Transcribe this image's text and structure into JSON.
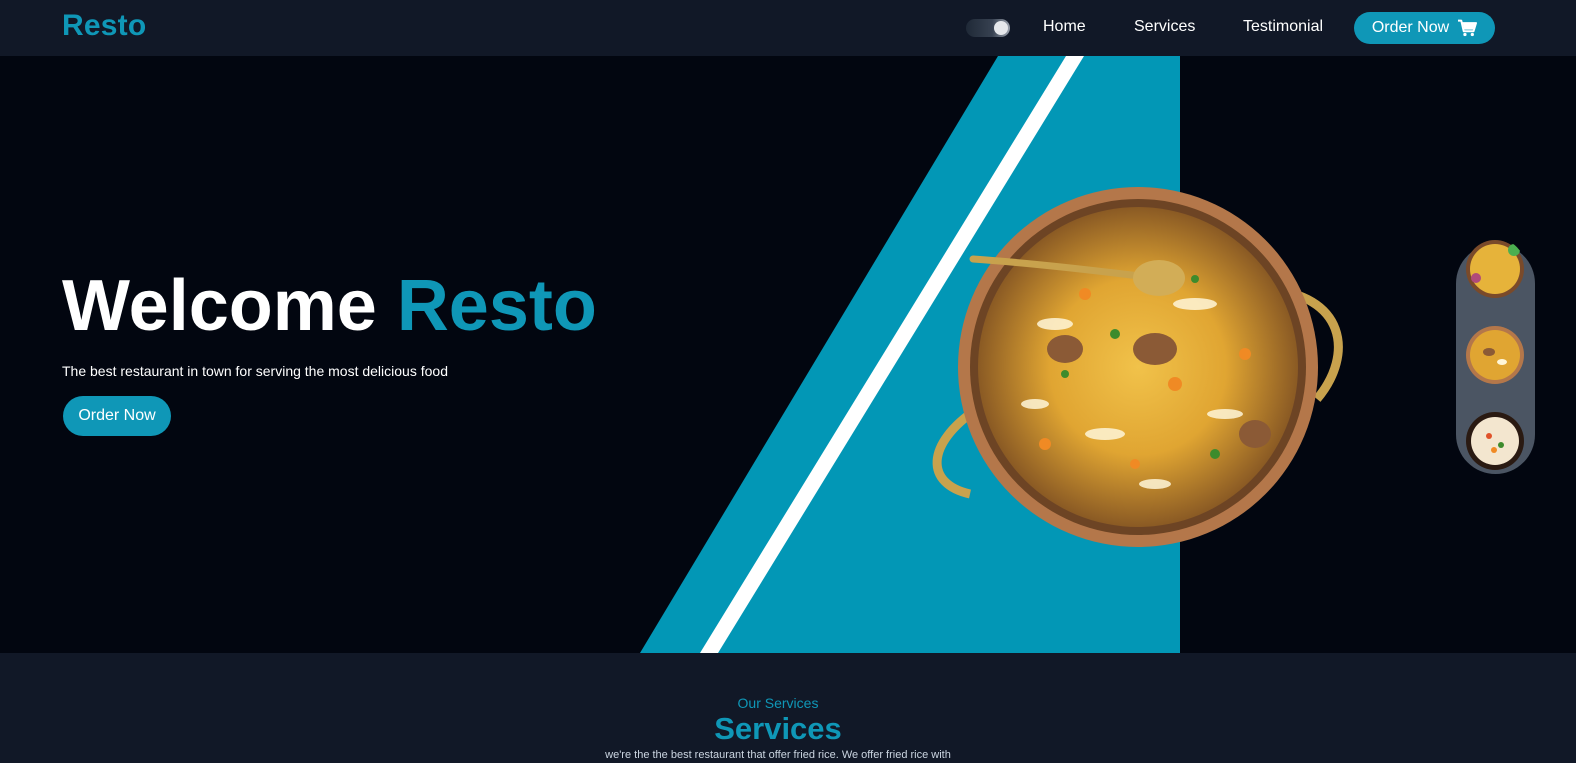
{
  "navbar": {
    "brand": "Resto",
    "toggle_icon": "theme-toggle-icon",
    "links": [
      {
        "label": "Home"
      },
      {
        "label": "Services"
      },
      {
        "label": "Testimonial"
      }
    ],
    "order_button": {
      "label": "Order Now",
      "icon": "cart-icon"
    }
  },
  "hero": {
    "title_prefix": "Welcome",
    "title_accent": "Resto",
    "subtitle": "The best restaurant in town for serving the most delicious food",
    "button_label": "Order Now",
    "images": [
      "biryani-dish-image"
    ],
    "thumbnails": [
      "dish-thumbnail-1",
      "dish-thumbnail-2",
      "dish-thumbnail-3"
    ]
  },
  "services": {
    "kicker": "Our Services",
    "title": "Services",
    "description": "we're the the best restaurant that offer fried rice. We offer fried rice with"
  },
  "colors": {
    "accent": "#0f97b7",
    "navbar_bg": "#111827",
    "hero_bg": "#020610",
    "rail_bg": "#4b5563"
  }
}
